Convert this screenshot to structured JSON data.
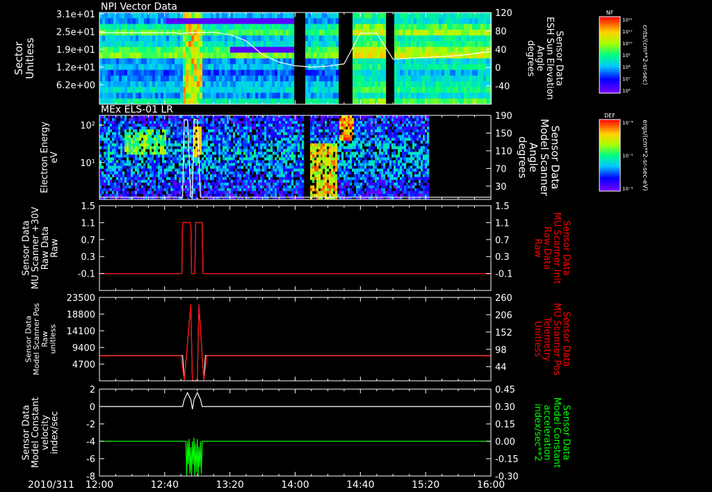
{
  "bottom": {
    "date": "2010/311"
  },
  "time_axis": {
    "start_min": 0,
    "end_min": 240,
    "ticks": [
      0,
      40,
      80,
      120,
      160,
      200,
      240
    ],
    "tick_labels": [
      "12:00",
      "12:40",
      "13:20",
      "14:00",
      "14:40",
      "15:20",
      "16:00"
    ]
  },
  "chart_data": [
    {
      "type": "heatmap",
      "title": "NPI Vector Data",
      "ylabel_left": [
        "Sector",
        "Unitless"
      ],
      "yticks_left": [
        "3.1e+01",
        "2.5e+01",
        "1.9e+01",
        "1.2e+01",
        "6.2e+00"
      ],
      "ylabel_right": [
        "Sensor Data",
        "ESH Sun Elevation",
        "Angle",
        "degrees"
      ],
      "ylim_right": [
        -80,
        120
      ],
      "yticks_right": [
        120,
        80,
        40,
        0,
        -40
      ],
      "gaps": [
        [
          119,
          126
        ],
        [
          145,
          154
        ],
        [
          175,
          180
        ]
      ],
      "line_series": {
        "color": "#ffffff",
        "x": [
          0,
          40,
          45,
          50,
          55,
          60,
          70,
          80,
          90,
          100,
          110,
          120,
          130,
          140,
          150,
          160,
          170,
          180,
          190,
          200,
          220,
          240
        ],
        "y": [
          76,
          76,
          76,
          74,
          76,
          76,
          77,
          72,
          58,
          28,
          12,
          4,
          1,
          3,
          8,
          75,
          75,
          18,
          20,
          22,
          26,
          35
        ]
      },
      "colorbar": {
        "title": "NF",
        "units": "cnts/(cm**2-sr-sec)",
        "tick_labels": [
          "10¹²",
          "10¹¹",
          "10¹⁰",
          "10⁹",
          "10⁸",
          "10⁷",
          "10⁶"
        ]
      }
    },
    {
      "type": "heatmap",
      "title": "MEx ELS-01 LR",
      "ylabel_left": [
        "Electron Energy",
        "eV"
      ],
      "yticks_left": [
        "10²",
        "10¹"
      ],
      "ylabel_right": [
        "Sensor Data",
        "Model Scanner",
        "Angle",
        "degrees"
      ],
      "ylim_right": [
        0,
        190
      ],
      "yticks_right": [
        190,
        150,
        110,
        70,
        30
      ],
      "data_end": 201,
      "gap": [
        125,
        129
      ],
      "line_series": {
        "color": "#ffffff",
        "x": [
          0,
          51,
          52,
          54,
          56,
          57,
          58,
          60,
          62,
          63,
          240
        ],
        "y": [
          5,
          5,
          180,
          180,
          5,
          5,
          180,
          180,
          5,
          5,
          5
        ]
      },
      "colorbar": {
        "title": "DEF",
        "units": "ergs/(cm**2-sr-sec-eV)",
        "tick_labels": [
          "10⁻⁴",
          "10⁻⁵",
          "10⁻⁶"
        ]
      }
    },
    {
      "type": "line",
      "ylabel_left": [
        "Sensor Data",
        "MU Scanner +30V",
        "Raw Data",
        "Raw"
      ],
      "ylim_left": [
        -0.5,
        1.5
      ],
      "yticks_left": [
        1.5,
        1.1,
        0.7,
        0.3,
        -0.1
      ],
      "ylabel_right": [
        "Sensor Data",
        "MU Scanner Init",
        "Raw Data",
        "Raw"
      ],
      "ylabel_right_color": "#ff0000",
      "ylim_right": [
        -0.5,
        1.5
      ],
      "yticks_right": [
        1.5,
        1.1,
        0.7,
        0.3,
        -0.1
      ],
      "series": [
        {
          "axis": "left",
          "color": "#ffffff",
          "x": [
            0,
            50.5,
            51,
            56,
            56.5,
            58.5,
            59,
            63,
            63.5,
            240
          ],
          "y": [
            -0.1,
            -0.1,
            1.1,
            1.1,
            -0.1,
            -0.1,
            1.1,
            1.1,
            -0.1,
            -0.1
          ]
        },
        {
          "axis": "right",
          "color": "#ff0000",
          "x": [
            0,
            50.5,
            51,
            56,
            56.5,
            58.5,
            59,
            63,
            63.5,
            240
          ],
          "y": [
            -0.1,
            -0.1,
            1.1,
            1.1,
            -0.1,
            -0.1,
            1.1,
            1.1,
            -0.1,
            -0.1
          ]
        }
      ]
    },
    {
      "type": "line",
      "ylabel_left": [
        "Sensor Data",
        "Model Scanner Pos",
        "Raw",
        "unitless"
      ],
      "ylim_left": [
        0,
        23500
      ],
      "yticks_left": [
        23500,
        18800,
        14100,
        9400,
        4700
      ],
      "ylabel_right": [
        "Sensor Data",
        "MU Scanner Pos",
        "Telemetry",
        "Unitless"
      ],
      "ylabel_right_color": "#ff0000",
      "ylim_right": [
        0,
        260
      ],
      "yticks_right": [
        260,
        206,
        152,
        98,
        44
      ],
      "series": [
        {
          "axis": "left",
          "color": "#ffffff",
          "x": [
            0,
            51,
            52,
            56,
            57,
            60,
            61,
            64,
            65,
            240
          ],
          "y": [
            7100,
            7100,
            0,
            21500,
            0,
            0,
            21500,
            0,
            7100,
            7100
          ]
        },
        {
          "axis": "right",
          "color": "#ff0000",
          "x": [
            0,
            50,
            52,
            56,
            57,
            60,
            61,
            64,
            66,
            240
          ],
          "y": [
            78,
            78,
            0,
            238,
            0,
            0,
            238,
            0,
            78,
            78
          ]
        }
      ]
    },
    {
      "type": "line",
      "ylabel_left": [
        "Sensor Data",
        "Model Constant",
        "velocity",
        "index/sec"
      ],
      "ylim_left": [
        -8,
        2
      ],
      "yticks_left": [
        2,
        0,
        -2,
        -4,
        -6,
        -8
      ],
      "ylabel_right": [
        "Sensor Data",
        "Model Constant",
        "acceleration",
        "index/sec**2"
      ],
      "ylabel_right_color": "#00ff00",
      "ylim_right": [
        -0.3,
        0.45
      ],
      "yticks_right": [
        "0.45",
        "0.30",
        "0.15",
        "0.00",
        "-0.15",
        "-0.30"
      ],
      "series": [
        {
          "axis": "left",
          "color": "#ffffff",
          "x": [
            0,
            51,
            52,
            54,
            56,
            57,
            58,
            60,
            62,
            63,
            240
          ],
          "y": [
            0,
            0,
            0.8,
            1.6,
            0.8,
            -0.3,
            0.8,
            1.6,
            0.8,
            0,
            0
          ]
        },
        {
          "axis": "right",
          "color": "#00ff00",
          "x": [
            0,
            53,
            53.5,
            54,
            54.5,
            55,
            55.5,
            56,
            56.5,
            57,
            57.5,
            58,
            58.5,
            59,
            59.5,
            60,
            60.5,
            61,
            61.5,
            62,
            62.5,
            63,
            240
          ],
          "y": [
            0,
            0,
            -0.3,
            0,
            -0.2,
            0.02,
            -0.28,
            -0.05,
            -0.3,
            0,
            -0.2,
            0.03,
            -0.3,
            -0.02,
            -0.27,
            0.02,
            -0.3,
            -0.05,
            -0.22,
            0,
            -0.28,
            0,
            0
          ]
        }
      ]
    }
  ]
}
